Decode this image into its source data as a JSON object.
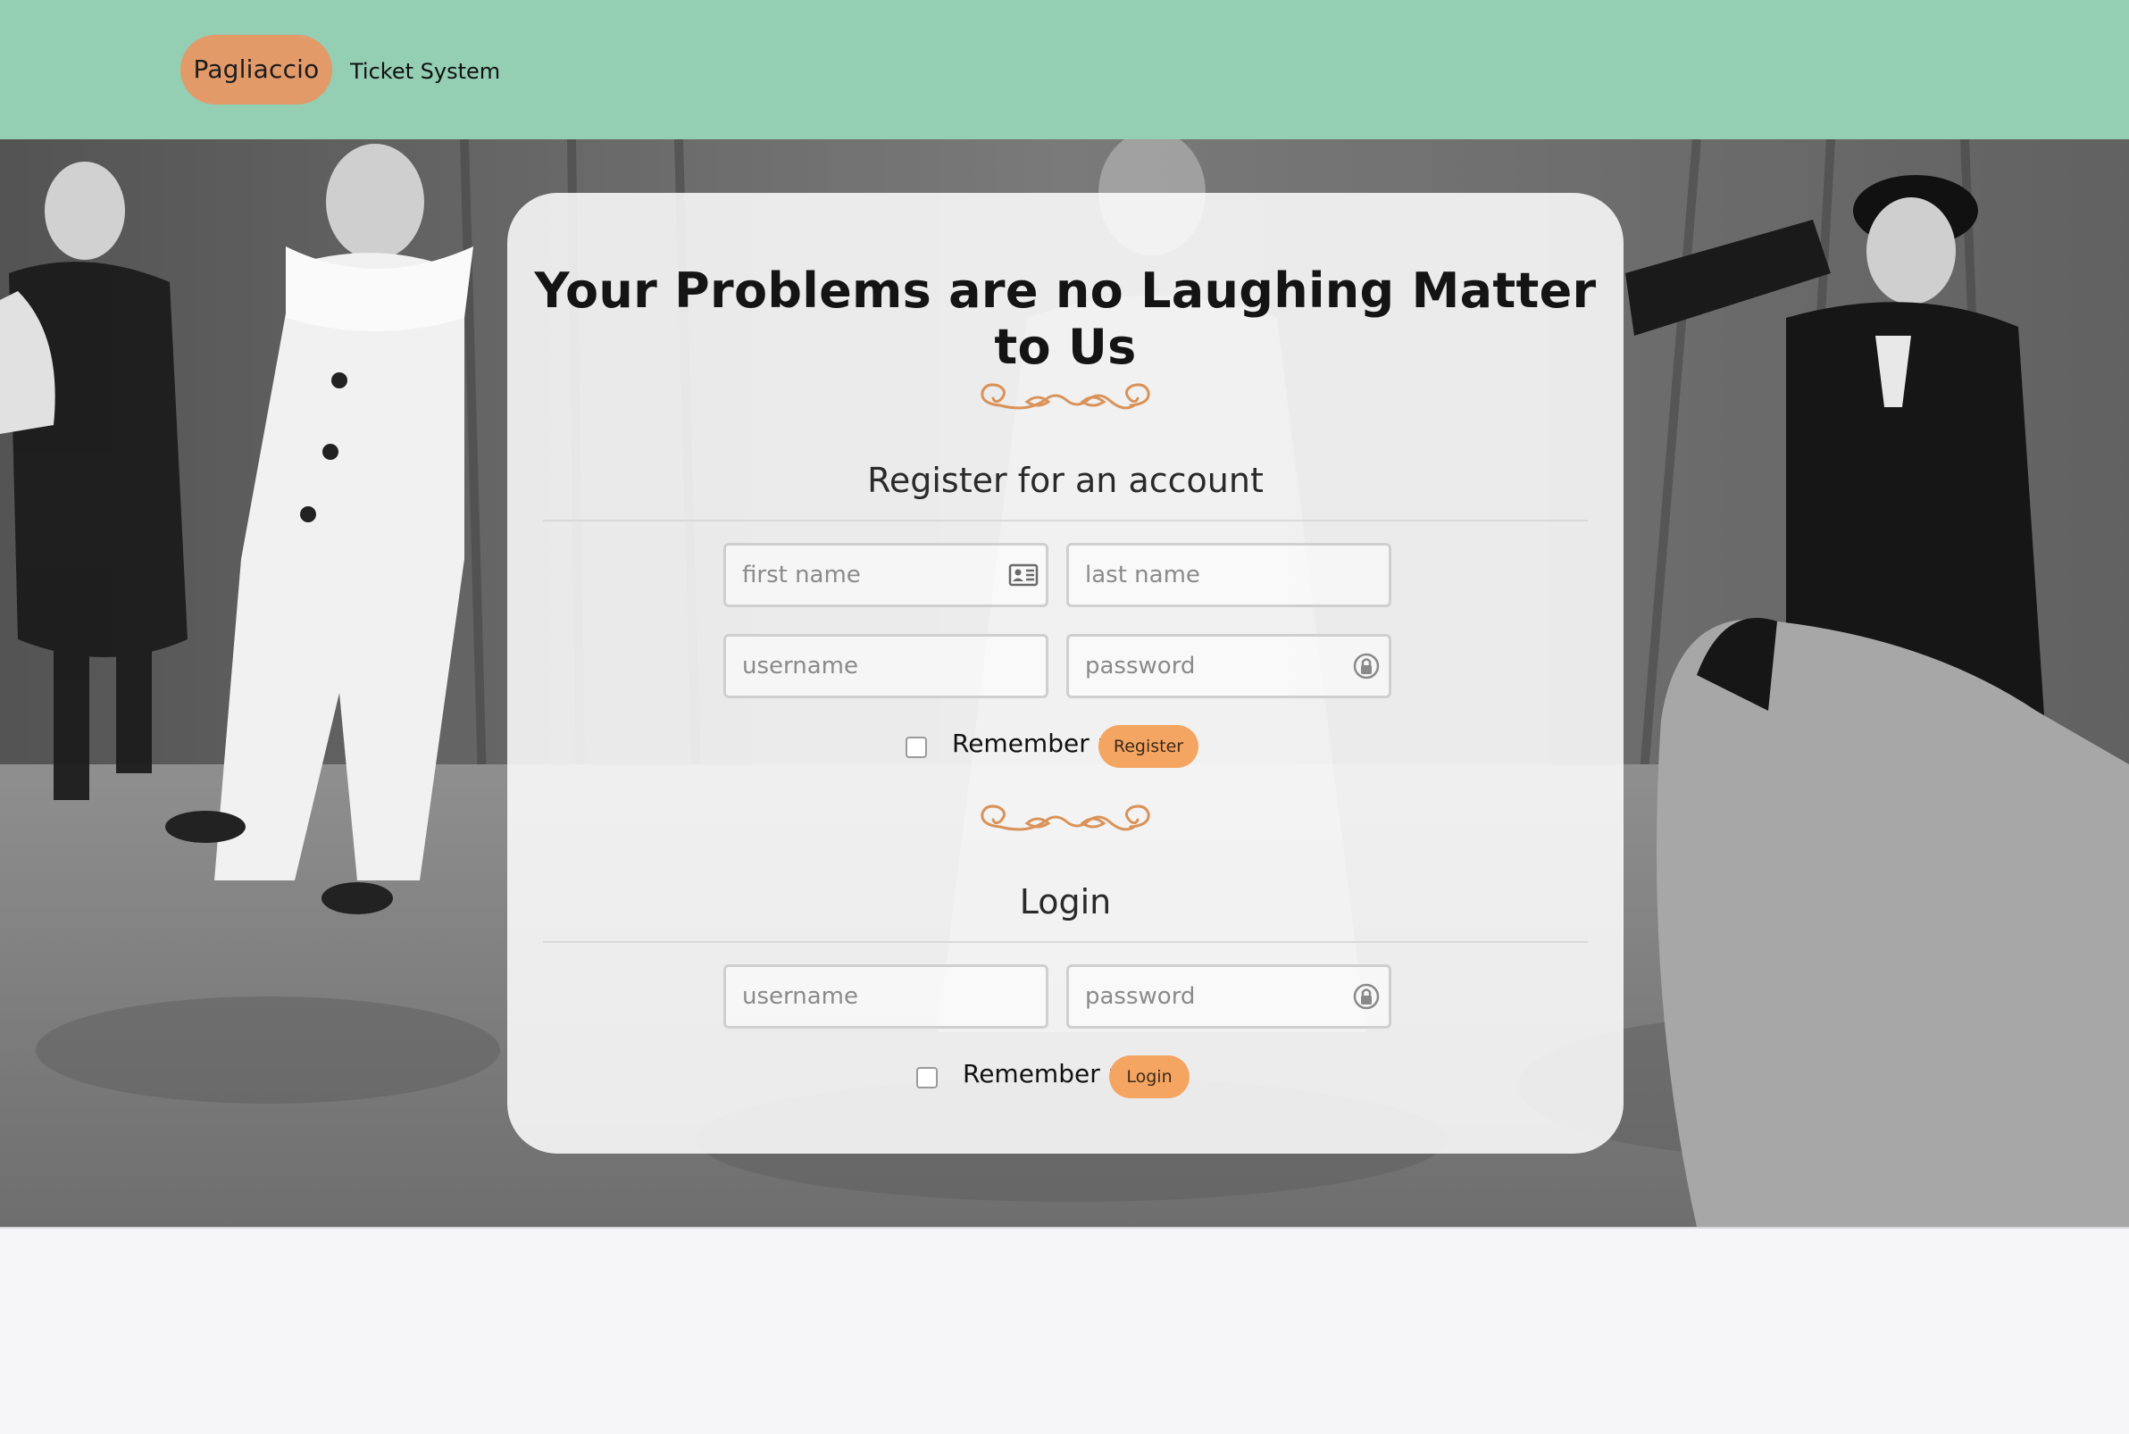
{
  "navbar": {
    "brand": "Pagliaccio",
    "link": "Ticket System",
    "bg_color": "#94ceb3",
    "brand_color": "#e29a69"
  },
  "card": {
    "headline": "Your Problems are no Laughing Matter to Us",
    "register": {
      "title": "Register for an account",
      "first_name_placeholder": "first name",
      "last_name_placeholder": "last name",
      "username_placeholder": "username",
      "password_placeholder": "password",
      "remember_label": "Remember me",
      "submit_label": "Register"
    },
    "login": {
      "title": "Login",
      "username_placeholder": "username",
      "password_placeholder": "password",
      "remember_label": "Remember me",
      "submit_label": "Login"
    },
    "accent_color": "#f4a561",
    "flourish_color": "#d9935a"
  },
  "icons": {
    "first_name_field": "id-card-icon",
    "password_field": "lock-icon",
    "divider": "flourish-ornament"
  }
}
